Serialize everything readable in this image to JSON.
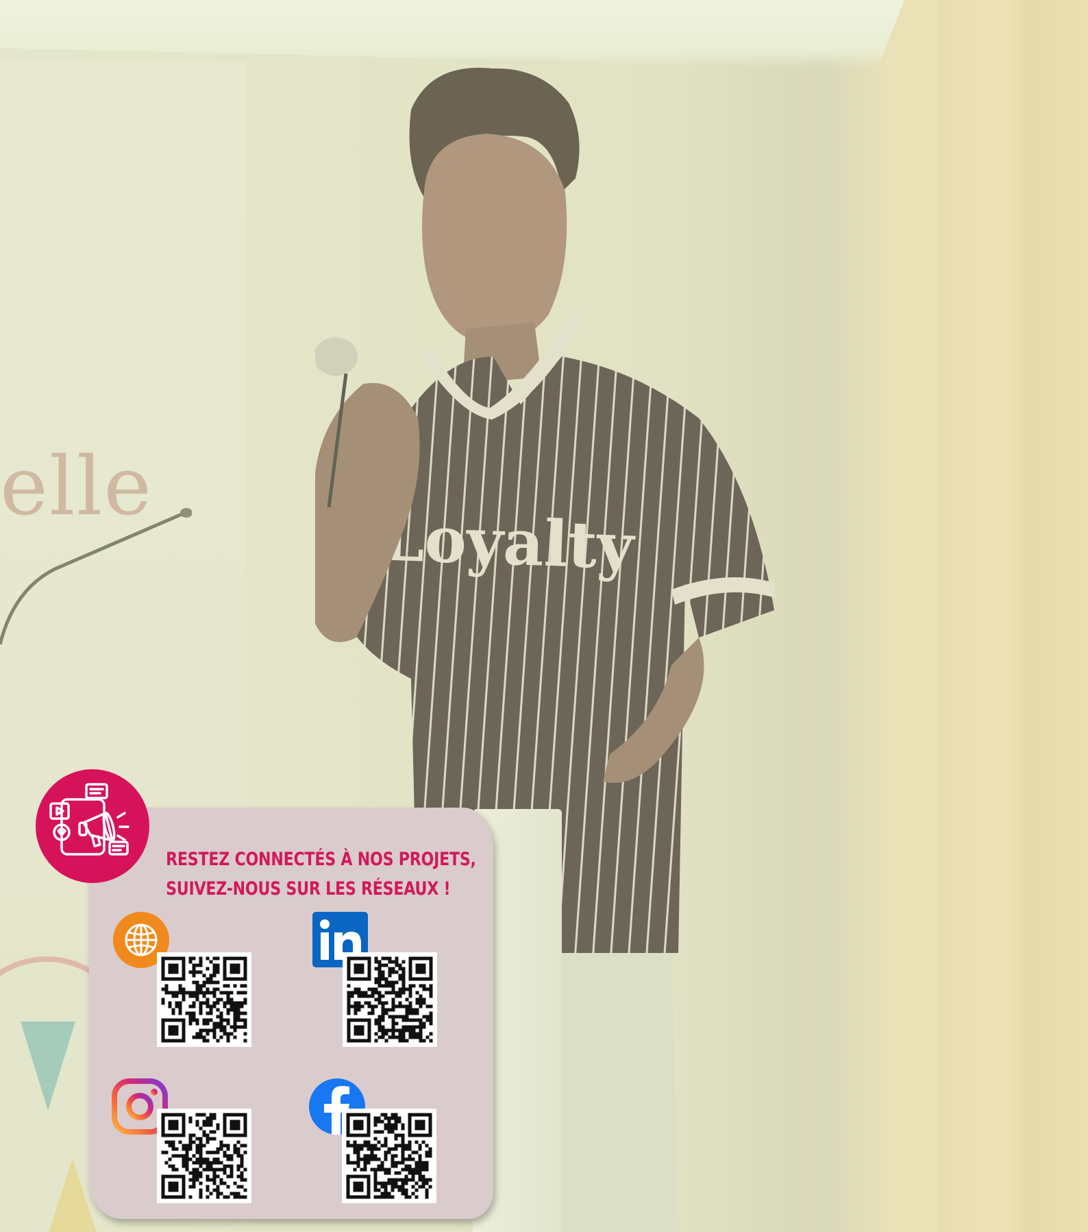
{
  "background": {
    "partial_sign_text": "elle",
    "shirt_text": "Loyalty"
  },
  "card": {
    "headline_line1": "RESTEZ CONNECTÉS À NOS PROJETS,",
    "headline_line2": "SUIVEZ-NOUS SUR LES RÉSEAUX !",
    "accent_color": "#d6125a",
    "panel_color": "#dacccc",
    "badge_icon": "social-media-megaphone-icon",
    "links": [
      {
        "network": "website",
        "icon": "globe-icon",
        "icon_color": "#f08a1c"
      },
      {
        "network": "linkedin",
        "icon": "linkedin-icon",
        "icon_color": "#0a66c2"
      },
      {
        "network": "instagram",
        "icon": "instagram-icon",
        "icon_color": "#d62976"
      },
      {
        "network": "facebook",
        "icon": "facebook-icon",
        "icon_color": "#1877f2"
      }
    ]
  }
}
